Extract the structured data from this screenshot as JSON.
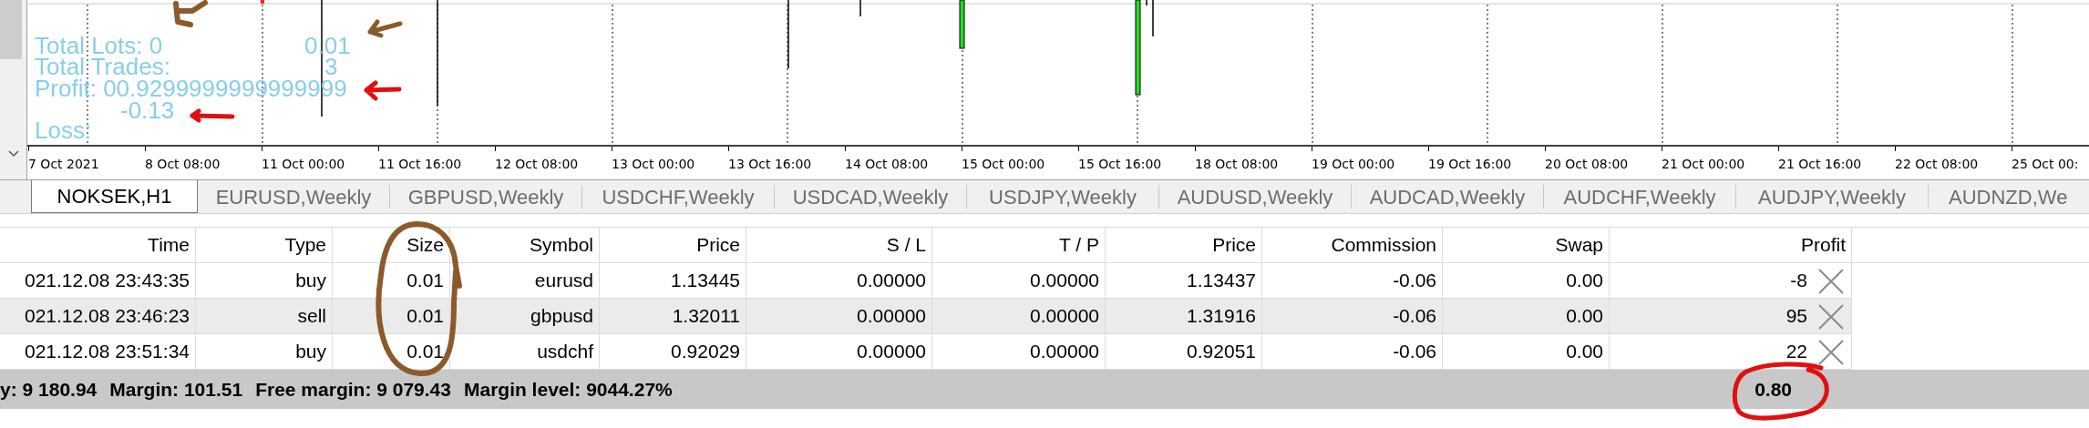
{
  "chart": {
    "stats": {
      "total_lots_label": "Total Lots: 0",
      "total_lots_value": "0.01",
      "total_trades_label": "Total Trades:",
      "total_trades_value": "3",
      "profit_label": "Profit: 00.9299999999999999",
      "loss_value": "-0.13",
      "loss_label": "Loss:"
    },
    "time_axis": [
      "7 Oct 2021",
      "8 Oct 08:00",
      "11 Oct 00:00",
      "11 Oct 16:00",
      "12 Oct 08:00",
      "13 Oct 00:00",
      "13 Oct 16:00",
      "14 Oct 08:00",
      "15 Oct 00:00",
      "15 Oct 16:00",
      "18 Oct 08:00",
      "19 Oct 00:00",
      "19 Oct 16:00",
      "20 Oct 08:00",
      "21 Oct 00:00",
      "21 Oct 16:00",
      "22 Oct 08:00",
      "25 Oct 00:"
    ]
  },
  "chart_tabs": [
    {
      "label": "NOKSEK,H1",
      "selected": true
    },
    {
      "label": "EURUSD,Weekly",
      "selected": false
    },
    {
      "label": "GBPUSD,Weekly",
      "selected": false
    },
    {
      "label": "USDCHF,Weekly",
      "selected": false
    },
    {
      "label": "USDCAD,Weekly",
      "selected": false
    },
    {
      "label": "USDJPY,Weekly",
      "selected": false
    },
    {
      "label": "AUDUSD,Weekly",
      "selected": false
    },
    {
      "label": "AUDCAD,Weekly",
      "selected": false
    },
    {
      "label": "AUDCHF,Weekly",
      "selected": false
    },
    {
      "label": "AUDJPY,Weekly",
      "selected": false
    },
    {
      "label": "AUDNZD,We",
      "selected": false
    }
  ],
  "trade_table": {
    "columns": [
      "Time",
      "Type",
      "Size",
      "Symbol",
      "Price",
      "S / L",
      "T / P",
      "Price",
      "Commission",
      "Swap",
      "Profit"
    ],
    "rows": [
      {
        "cells": [
          "021.12.08 23:43:35",
          "buy",
          "0.01",
          "eurusd",
          "1.13445",
          "0.00000",
          "0.00000",
          "1.13437",
          "-0.06",
          "0.00",
          "-8"
        ]
      },
      {
        "cells": [
          "021.12.08 23:46:23",
          "sell",
          "0.01",
          "gbpusd",
          "1.32011",
          "0.00000",
          "0.00000",
          "1.31916",
          "-0.06",
          "0.00",
          "95"
        ]
      },
      {
        "cells": [
          "021.12.08 23:51:34",
          "buy",
          "0.01",
          "usdchf",
          "0.92029",
          "0.00000",
          "0.00000",
          "0.92051",
          "-0.06",
          "0.00",
          "22"
        ]
      }
    ]
  },
  "summary": {
    "items": [
      "y: 9 180.94",
      "Margin: 101.51",
      "Free margin: 9 079.43",
      "Margin level: 9044.27%"
    ],
    "total_profit": "0.80"
  }
}
